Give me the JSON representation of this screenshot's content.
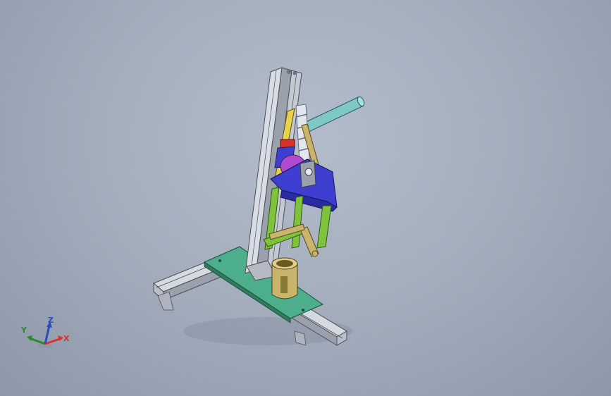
{
  "viewport": {
    "background_top": "#b3bccb",
    "background_bottom": "#8d97a8"
  },
  "triad": {
    "x_label": "X",
    "y_label": "Y",
    "z_label": "Z",
    "x_color": "#e0302a",
    "y_color": "#2a8a2a",
    "z_color": "#2a4ac0"
  },
  "model": {
    "colors": {
      "aluminum": "#c9cdd6",
      "aluminum_dark": "#6a6f7a",
      "base_plate": "#4cae8a",
      "arm_green": "#7fc23c",
      "top_plate": "#3e3fd0",
      "magenta": "#b04ad0",
      "handle": "#7fc8c8",
      "brass": "#c8b46a",
      "red": "#d8302a"
    }
  }
}
